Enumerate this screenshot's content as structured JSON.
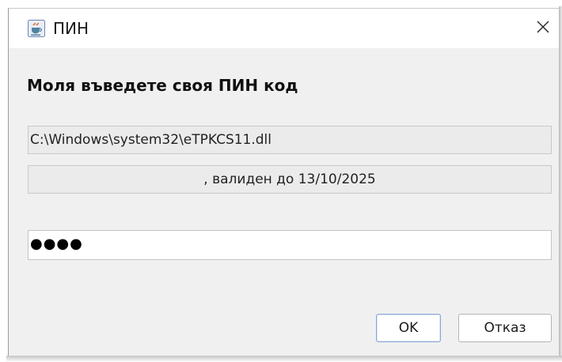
{
  "window": {
    "title": "ПИН",
    "app_icon": "java-coffee-cup-icon",
    "close_icon": "close-icon"
  },
  "dialog": {
    "heading": "Моля въведете своя ПИН код",
    "library_path": "C:\\Windows\\system32\\eTPKCS11.dll",
    "certificate_validity": ", валиден до 13/10/2025",
    "pin_value_masked": "●●●●"
  },
  "buttons": {
    "ok_label": "OK",
    "cancel_label": "Отказ"
  },
  "colors": {
    "dialog_background": "#f0f0f0",
    "titlebar_background": "#ffffff",
    "default_button_border": "#8aa6d6"
  }
}
